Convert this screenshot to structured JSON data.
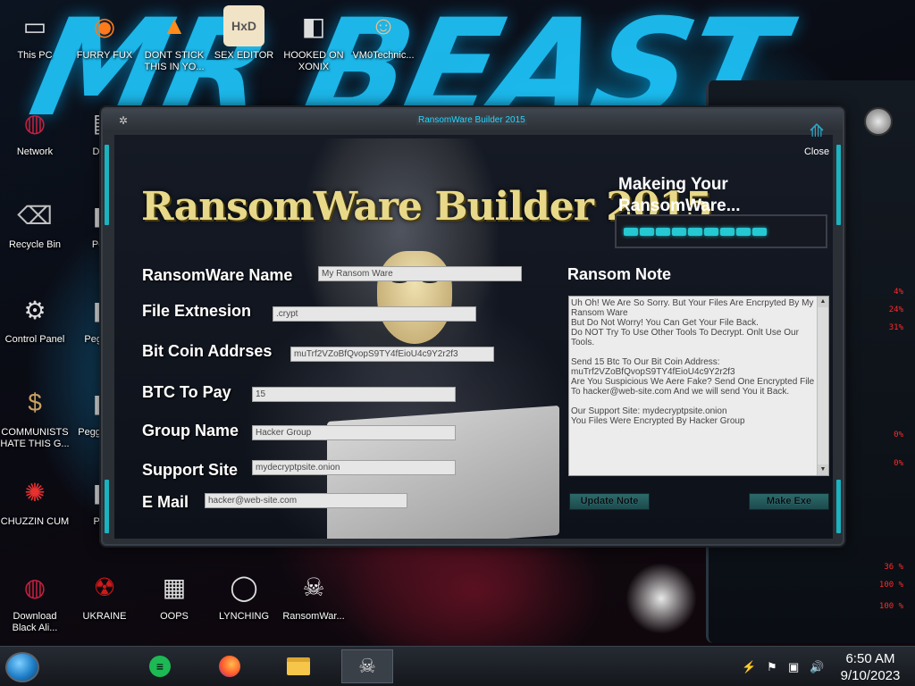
{
  "window": {
    "title": "RansomWare Builder 2015",
    "logo_text": "RansomWare Builder 2015",
    "status_text": "Makeing Your RansomWare...",
    "close_label": "Close"
  },
  "form": {
    "ransomware_name_label": "RansomWare Name",
    "ransomware_name_value": "My Ransom Ware",
    "file_extension_label": "File Extnesion",
    "file_extension_value": ".crypt",
    "bitcoin_address_label": "Bit Coin Addrses",
    "bitcoin_address_value": "muTrf2VZoBfQvopS9TY4fEioU4c9Y2r2f3",
    "btc_to_pay_label": "BTC To Pay",
    "btc_to_pay_value": "15",
    "group_name_label": "Group Name",
    "group_name_value": "Hacker Group",
    "support_site_label": "Support Site",
    "support_site_value": "mydecryptpsite.onion",
    "email_label": "E Mail",
    "email_value": "hacker@web-site.com"
  },
  "note": {
    "label": "Ransom Note",
    "text": "Uh Oh! We Are So Sorry. But Your Files Are Encrpyted By My Ransom Ware\nBut Do Not Worry! You Can Get Your File Back.\nDo NOT Try To Use Other Tools To Decrypt. Onlt Use Our Tools.\n\nSend 15 Btc To Our Bit Coin Address: muTrf2VZoBfQvopS9TY4fEioU4c9Y2r2f3\nAre You Suspicious We Aere Fake? Send One Encrypted File To hacker@web-site.com And we will send You it Back.\n\nOur Support Site: mydecryptpsite.onion\nYou Files Were Encrypted By Hacker Group"
  },
  "buttons": {
    "update_note": "Update Note",
    "make_exe": "Make Exe"
  },
  "progress": {
    "filled_segments": 9,
    "total_segments": 9
  },
  "desktop_icons": [
    {
      "label": "This PC",
      "icon": "computer-icon"
    },
    {
      "label": "FURRY FUX",
      "icon": "firefox-icon"
    },
    {
      "label": "DONT STICK THIS IN YO...",
      "icon": "traffic-cone-icon"
    },
    {
      "label": "SEX EDITOR",
      "icon": "hxd-editor-icon"
    },
    {
      "label": "HOOKED ON XONIX",
      "icon": "game-icon"
    },
    {
      "label": "VM0Technic...",
      "icon": "doctor-icon"
    },
    {
      "label": "Network",
      "icon": "network-icon"
    },
    {
      "label": "D DU",
      "icon": "app-icon"
    },
    {
      "label": "Recycle Bin",
      "icon": "recycle-bin-icon"
    },
    {
      "label": "Peggl",
      "icon": "game-icon"
    },
    {
      "label": "Control Panel",
      "icon": "control-panel-icon"
    },
    {
      "label": "Peggl De",
      "icon": "game-icon"
    },
    {
      "label": "COMMUNISTS HATE THIS G...",
      "icon": "money-bag-icon"
    },
    {
      "label": "Peggl of Wa",
      "icon": "game-icon"
    },
    {
      "label": "CHUZZIN CUM",
      "icon": "chuzzle-icon"
    },
    {
      "label": "Pl Zc",
      "icon": "game-icon"
    },
    {
      "label": "Download Black Ali...",
      "icon": "alienware-icon"
    },
    {
      "label": "UKRAINE",
      "icon": "radiation-icon"
    },
    {
      "label": "OOPS",
      "icon": "book-icon"
    },
    {
      "label": "LYNCHING",
      "icon": "noose-icon"
    },
    {
      "label": "RansomWar...",
      "icon": "skull-icon"
    }
  ],
  "gadget": {
    "readouts": [
      "4%",
      "24%",
      "31%",
      "0%",
      "0%",
      "36 %",
      "100 %",
      "100 %"
    ]
  },
  "wallpaper": {
    "text": "MR BEAST"
  },
  "taskbar": {
    "items": [
      {
        "icon": "spotify-icon"
      },
      {
        "icon": "firefox-icon"
      },
      {
        "icon": "file-explorer-icon"
      },
      {
        "icon": "skull-icon"
      }
    ],
    "time": "6:50 AM",
    "date": "9/10/2023"
  },
  "colors": {
    "accent": "#1ab3bf",
    "title": "#20d8ff",
    "logo": "#e8d98a"
  }
}
